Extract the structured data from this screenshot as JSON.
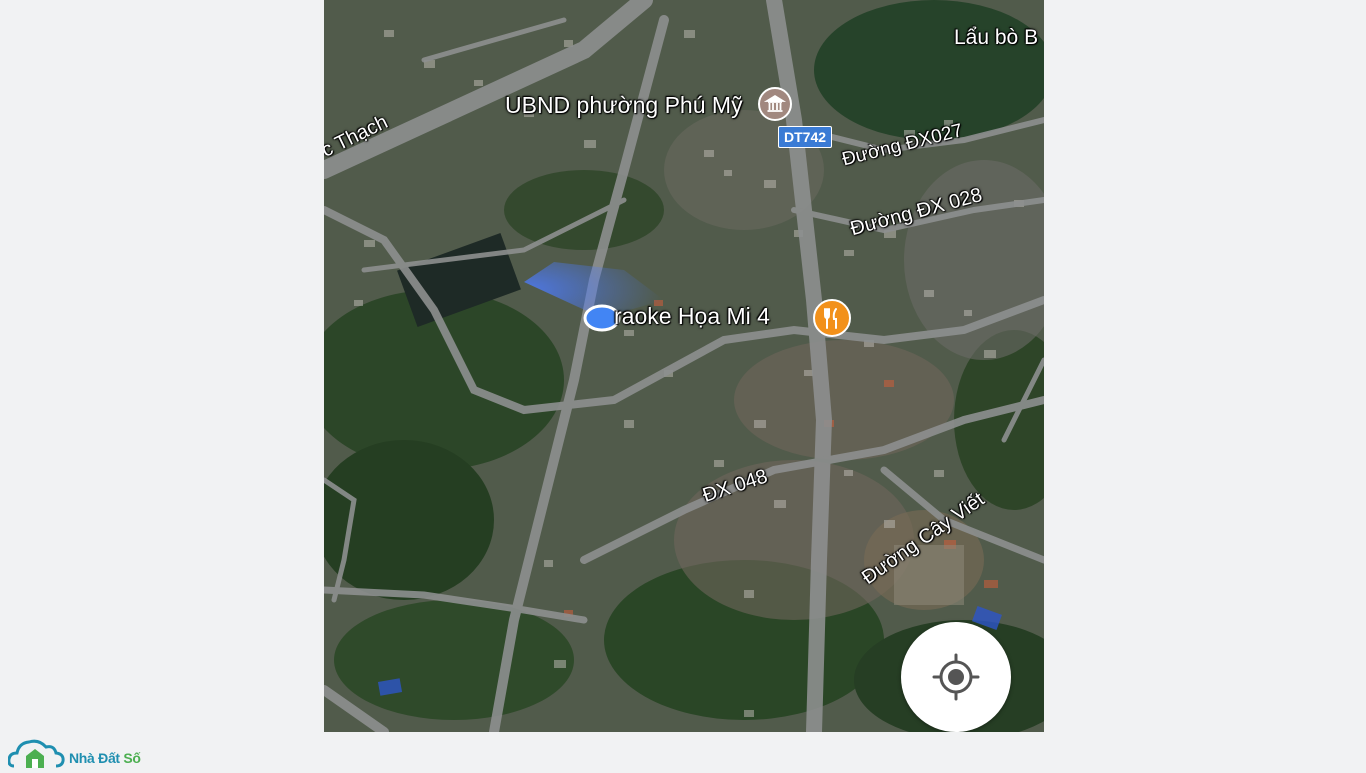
{
  "map": {
    "place_labels": {
      "ubnd": "UBND phường Phú Mỹ",
      "karaoke": "raoke Họa Mi 4",
      "lau_bo": "Lẩu bò B"
    },
    "road_labels": {
      "thach": "c Thạch",
      "dx027": "Đường ĐX027",
      "dx028": "Đường ĐX 028",
      "dx048": "ĐX 048",
      "cay_viet": "Đường Cây Viết"
    },
    "route_shield": "DT742",
    "icons": {
      "ubnd": "government-building-icon",
      "karaoke": "restaurant-icon",
      "my_location": "my-location-icon"
    },
    "colors": {
      "restaurant_poi": "#f2911b",
      "government_poi": "#a1887f",
      "route_shield": "#3a7bd5",
      "location_dot": "#4285f4"
    }
  },
  "logo": {
    "text_primary": "Nhà Đất",
    "text_accent": "Số",
    "primary_color": "#1f8fb0",
    "accent_color": "#4caf50"
  }
}
